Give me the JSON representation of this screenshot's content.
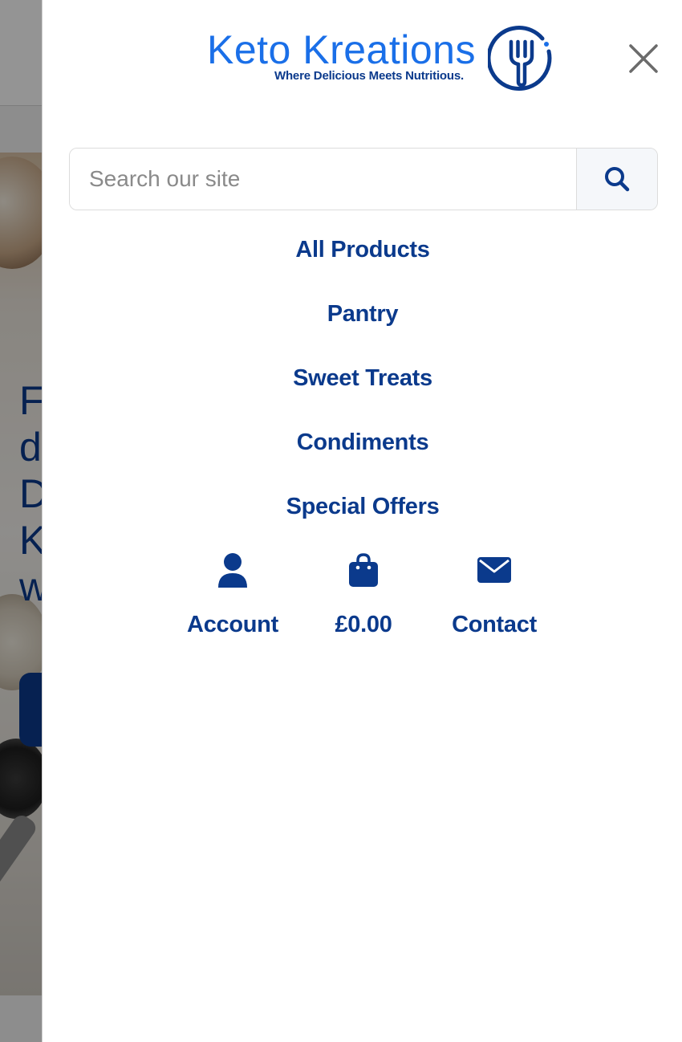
{
  "background_page": {
    "heading_fragments": [
      "F",
      "d",
      "D",
      "K",
      "w"
    ]
  },
  "brand": {
    "name": "Keto Kreations",
    "tagline": "Where Delicious Meets Nutritious.",
    "primary_color": "#0b3a8c",
    "accent_color": "#1a6fe8"
  },
  "drawer": {
    "close_icon": "close-icon"
  },
  "search": {
    "placeholder": "Search our site",
    "value": "",
    "button_icon": "search-icon"
  },
  "menu": {
    "items": [
      {
        "label": "All Products"
      },
      {
        "label": "Pantry"
      },
      {
        "label": "Sweet Treats"
      },
      {
        "label": "Condiments"
      },
      {
        "label": "Special Offers"
      }
    ]
  },
  "actions": {
    "account": {
      "label": "Account",
      "icon": "user-icon"
    },
    "cart": {
      "label": "£0.00",
      "icon": "shopping-bag-icon"
    },
    "contact": {
      "label": "Contact",
      "icon": "envelope-icon"
    }
  }
}
